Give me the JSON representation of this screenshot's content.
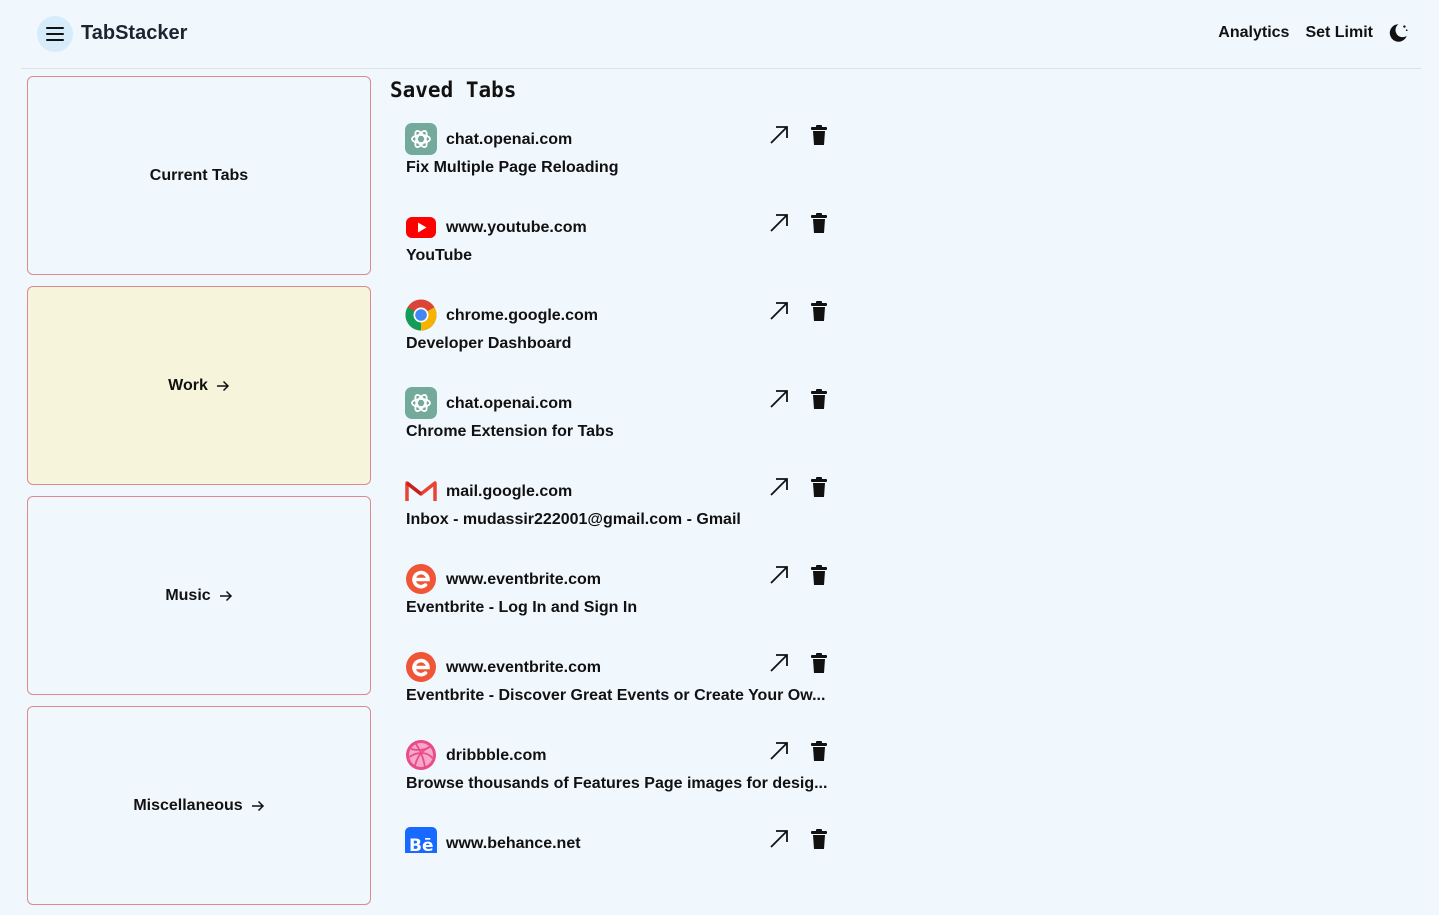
{
  "header": {
    "app_title": "TabStacker",
    "nav": {
      "analytics": "Analytics",
      "set_limit": "Set Limit"
    }
  },
  "sidebar": {
    "items": [
      {
        "label": "Current Tabs",
        "has_arrow": false,
        "active": false
      },
      {
        "label": "Work",
        "has_arrow": true,
        "active": true
      },
      {
        "label": "Music",
        "has_arrow": true,
        "active": false
      },
      {
        "label": "Miscellaneous",
        "has_arrow": true,
        "active": false
      }
    ]
  },
  "main": {
    "title": "Saved  Tabs",
    "tabs": [
      {
        "domain": "chat.openai.com",
        "title": "Fix Multiple Page Reloading",
        "icon": "openai-icon"
      },
      {
        "domain": "www.youtube.com",
        "title": "YouTube",
        "icon": "youtube-icon"
      },
      {
        "domain": "chrome.google.com",
        "title": "Developer Dashboard",
        "icon": "chrome-icon"
      },
      {
        "domain": "chat.openai.com",
        "title": "Chrome Extension for Tabs",
        "icon": "openai-icon"
      },
      {
        "domain": "mail.google.com",
        "title": "Inbox - mudassir222001@gmail.com - Gmail",
        "icon": "gmail-icon"
      },
      {
        "domain": "www.eventbrite.com",
        "title": "Eventbrite - Log In and Sign In",
        "icon": "eventbrite-icon"
      },
      {
        "domain": "www.eventbrite.com",
        "title": "Eventbrite - Discover Great Events or Create Your Ow...",
        "icon": "eventbrite-icon"
      },
      {
        "domain": "dribbble.com",
        "title": "Browse thousands of Features Page images for desig...",
        "icon": "dribbble-icon"
      },
      {
        "domain": "www.behance.net",
        "title": "",
        "icon": "behance-icon"
      }
    ]
  },
  "colors": {
    "background": "#f0f7fd",
    "card_border": "#dc8a8e",
    "active_card": "#f6f5dc",
    "menu_button": "#d6ecfa"
  }
}
